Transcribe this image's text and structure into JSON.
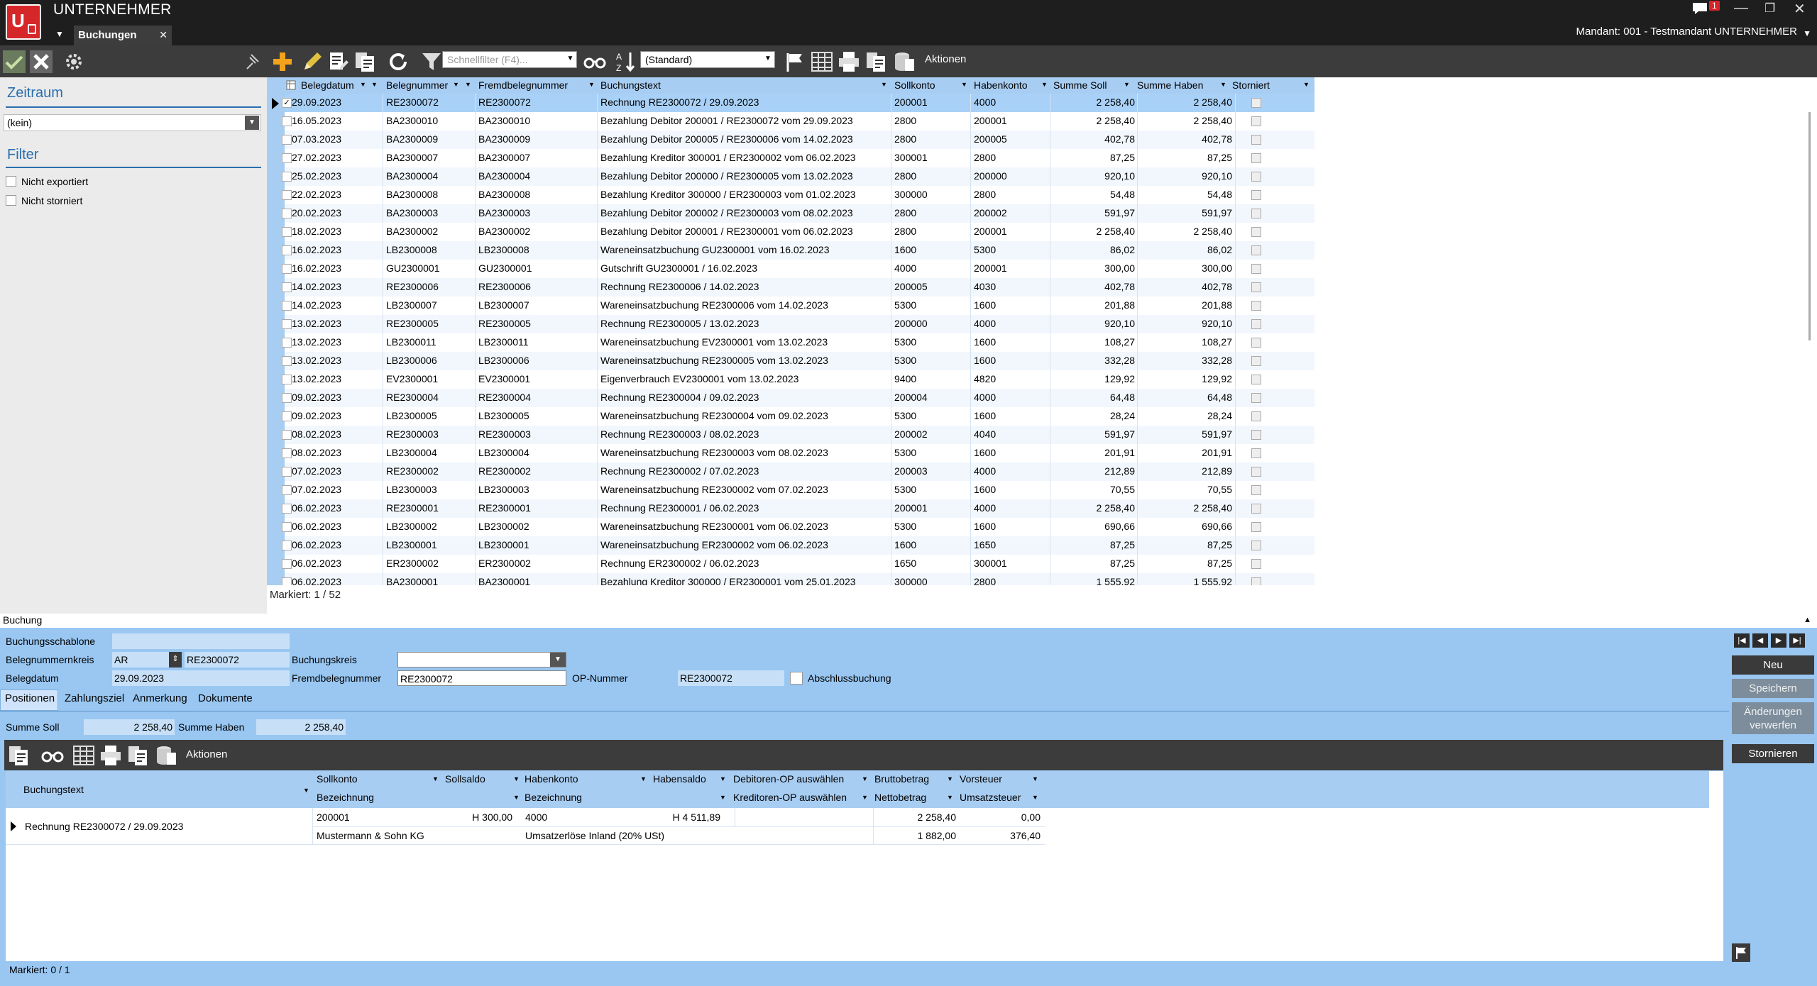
{
  "app": {
    "title": "UNTERNEHMER",
    "tab": "Buchungen",
    "notification_count": "1",
    "mandant": "Mandant: 001 - Testmandant UNTERNEHMER"
  },
  "toolbar": {
    "quickfilter_placeholder": "Schnellfilter (F4)...",
    "sort_value": "(Standard)",
    "actions_label": "Aktionen"
  },
  "left": {
    "zeitraum_title": "Zeitraum",
    "zeitraum_value": "(kein)",
    "filter_title": "Filter",
    "filter_not_exported": "Nicht exportiert",
    "filter_not_cancelled": "Nicht storniert"
  },
  "grid": {
    "columns": [
      "Belegdatum",
      "Belegnummer",
      "Fremdbelegnummer",
      "Buchungstext",
      "Sollkonto",
      "Habenkonto",
      "Summe Soll",
      "Summe Haben",
      "Storniert"
    ],
    "rows": [
      [
        "29.09.2023",
        "RE2300072",
        "RE2300072",
        "Rechnung RE2300072 / 29.09.2023",
        "200001",
        "4000",
        "2 258,40",
        "2 258,40"
      ],
      [
        "16.05.2023",
        "BA2300010",
        "BA2300010",
        "Bezahlung Debitor 200001 / RE2300072 vom 29.09.2023",
        "2800",
        "200001",
        "2 258,40",
        "2 258,40"
      ],
      [
        "07.03.2023",
        "BA2300009",
        "BA2300009",
        "Bezahlung Debitor 200005 / RE2300006 vom 14.02.2023",
        "2800",
        "200005",
        "402,78",
        "402,78"
      ],
      [
        "27.02.2023",
        "BA2300007",
        "BA2300007",
        "Bezahlung Kreditor 300001 / ER2300002 vom 06.02.2023",
        "300001",
        "2800",
        "87,25",
        "87,25"
      ],
      [
        "25.02.2023",
        "BA2300004",
        "BA2300004",
        "Bezahlung Debitor 200000 / RE2300005 vom 13.02.2023",
        "2800",
        "200000",
        "920,10",
        "920,10"
      ],
      [
        "22.02.2023",
        "BA2300008",
        "BA2300008",
        "Bezahlung Kreditor 300000 / ER2300003 vom 01.02.2023",
        "300000",
        "2800",
        "54,48",
        "54,48"
      ],
      [
        "20.02.2023",
        "BA2300003",
        "BA2300003",
        "Bezahlung Debitor 200002 / RE2300003 vom 08.02.2023",
        "2800",
        "200002",
        "591,97",
        "591,97"
      ],
      [
        "18.02.2023",
        "BA2300002",
        "BA2300002",
        "Bezahlung Debitor 200001 / RE2300001 vom 06.02.2023",
        "2800",
        "200001",
        "2 258,40",
        "2 258,40"
      ],
      [
        "16.02.2023",
        "LB2300008",
        "LB2300008",
        "Wareneinsatzbuchung GU2300001 vom 16.02.2023",
        "1600",
        "5300",
        "86,02",
        "86,02"
      ],
      [
        "16.02.2023",
        "GU2300001",
        "GU2300001",
        "Gutschrift GU2300001 / 16.02.2023",
        "4000",
        "200001",
        "300,00",
        "300,00"
      ],
      [
        "14.02.2023",
        "RE2300006",
        "RE2300006",
        "Rechnung RE2300006 / 14.02.2023",
        "200005",
        "4030",
        "402,78",
        "402,78"
      ],
      [
        "14.02.2023",
        "LB2300007",
        "LB2300007",
        "Wareneinsatzbuchung RE2300006 vom 14.02.2023",
        "5300",
        "1600",
        "201,88",
        "201,88"
      ],
      [
        "13.02.2023",
        "RE2300005",
        "RE2300005",
        "Rechnung RE2300005 / 13.02.2023",
        "200000",
        "4000",
        "920,10",
        "920,10"
      ],
      [
        "13.02.2023",
        "LB2300011",
        "LB2300011",
        "Wareneinsatzbuchung EV2300001 vom 13.02.2023",
        "5300",
        "1600",
        "108,27",
        "108,27"
      ],
      [
        "13.02.2023",
        "LB2300006",
        "LB2300006",
        "Wareneinsatzbuchung RE2300005 vom 13.02.2023",
        "5300",
        "1600",
        "332,28",
        "332,28"
      ],
      [
        "13.02.2023",
        "EV2300001",
        "EV2300001",
        "Eigenverbrauch EV2300001 vom 13.02.2023",
        "9400",
        "4820",
        "129,92",
        "129,92"
      ],
      [
        "09.02.2023",
        "RE2300004",
        "RE2300004",
        "Rechnung RE2300004 / 09.02.2023",
        "200004",
        "4000",
        "64,48",
        "64,48"
      ],
      [
        "09.02.2023",
        "LB2300005",
        "LB2300005",
        "Wareneinsatzbuchung RE2300004 vom 09.02.2023",
        "5300",
        "1600",
        "28,24",
        "28,24"
      ],
      [
        "08.02.2023",
        "RE2300003",
        "RE2300003",
        "Rechnung RE2300003 / 08.02.2023",
        "200002",
        "4040",
        "591,97",
        "591,97"
      ],
      [
        "08.02.2023",
        "LB2300004",
        "LB2300004",
        "Wareneinsatzbuchung RE2300003 vom 08.02.2023",
        "5300",
        "1600",
        "201,91",
        "201,91"
      ],
      [
        "07.02.2023",
        "RE2300002",
        "RE2300002",
        "Rechnung RE2300002 / 07.02.2023",
        "200003",
        "4000",
        "212,89",
        "212,89"
      ],
      [
        "07.02.2023",
        "LB2300003",
        "LB2300003",
        "Wareneinsatzbuchung RE2300002 vom 07.02.2023",
        "5300",
        "1600",
        "70,55",
        "70,55"
      ],
      [
        "06.02.2023",
        "RE2300001",
        "RE2300001",
        "Rechnung RE2300001 / 06.02.2023",
        "200001",
        "4000",
        "2 258,40",
        "2 258,40"
      ],
      [
        "06.02.2023",
        "LB2300002",
        "LB2300002",
        "Wareneinsatzbuchung RE2300001 vom 06.02.2023",
        "5300",
        "1600",
        "690,66",
        "690,66"
      ],
      [
        "06.02.2023",
        "LB2300001",
        "LB2300001",
        "Wareneinsatzbuchung ER2300002 vom 06.02.2023",
        "1600",
        "1650",
        "87,25",
        "87,25"
      ],
      [
        "06.02.2023",
        "ER2300002",
        "ER2300002",
        "Rechnung ER2300002 / 06.02.2023",
        "1650",
        "300001",
        "87,25",
        "87,25"
      ],
      [
        "06.02.2023",
        "BA2300001",
        "BA2300001",
        "Bezahlung Kreditor 300000 / ER2300001 vom 25.01.2023",
        "300000",
        "2800",
        "1 555,92",
        "1 555,92"
      ]
    ],
    "marked": "Markiert: 1 / 52"
  },
  "buchung": {
    "panel_title": "Buchung",
    "l_schablone": "Buchungsschablone",
    "l_nummernkreis": "Belegnummernkreis",
    "nummernkreis": "AR",
    "belegnummer": "RE2300072",
    "l_buchungskreis": "Buchungskreis",
    "l_belegdatum": "Belegdatum",
    "belegdatum": "29.09.2023",
    "l_fremd": "Fremdbelegnummer",
    "fremd": "RE2300072",
    "l_op": "OP-Nummer",
    "op": "RE2300072",
    "l_abschluss": "Abschlussbuchung",
    "tabs": [
      "Positionen",
      "Zahlungsziel",
      "Anmerkung",
      "Dokumente"
    ],
    "l_summe_soll": "Summe Soll",
    "summe_soll": "2 258,40",
    "l_summe_haben": "Summe Haben",
    "summe_haben": "2 258,40",
    "actions_label": "Aktionen",
    "pos_head": {
      "buchungstext": "Buchungstext",
      "sollkonto": "Sollkonto",
      "sollsaldo": "Sollsaldo",
      "habenkonto": "Habenkonto",
      "habensaldo": "Habensaldo",
      "debitor": "Debitoren-OP auswählen",
      "brutto": "Bruttobetrag",
      "vorsteuer": "Vorsteuer",
      "bez1": "Bezeichnung",
      "bez2": "Bezeichnung",
      "kreditor": "Kreditoren-OP auswählen",
      "netto": "Nettobetrag",
      "ust": "Umsatzsteuer"
    },
    "pos": {
      "buchungstext": "Rechnung RE2300072 / 29.09.2023",
      "sollkonto": "200001",
      "sollsaldo": "H 300,00",
      "habenkonto": "4000",
      "habensaldo": "H 4 511,89",
      "brutto": "2 258,40",
      "vorsteuer": "0,00",
      "soll_bez": "Mustermann & Sohn KG",
      "haben_bez": "Umsatzerlöse Inland (20% USt)",
      "netto": "1 882,00",
      "ust": "376,40"
    },
    "marked": "Markiert: 0 / 1"
  },
  "right_buttons": {
    "neu": "Neu",
    "speichern": "Speichern",
    "verwerfen1": "Änderungen",
    "verwerfen2": "verwerfen",
    "stornieren": "Stornieren"
  }
}
